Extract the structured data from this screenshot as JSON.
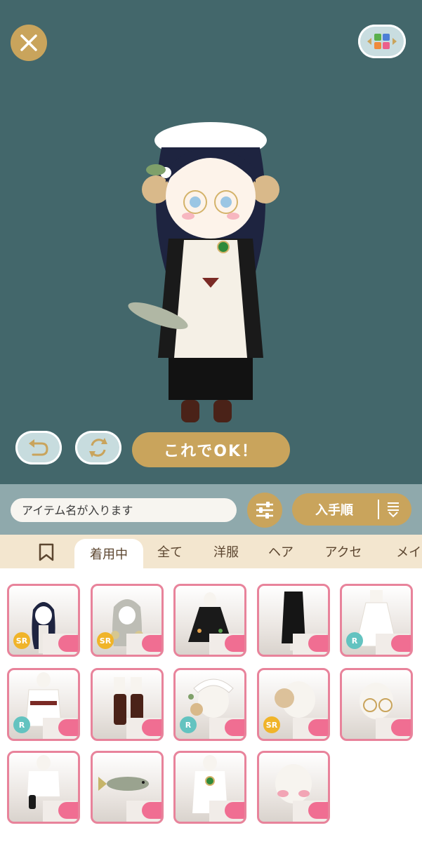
{
  "buttons": {
    "ok_label": "これでOK！",
    "close": "close-icon",
    "layout": "layout-grid-icon",
    "undo": "undo-icon",
    "swap": "swap-icon"
  },
  "search": {
    "placeholder": "アイテム名が入ります"
  },
  "sort": {
    "label": "入手順"
  },
  "tabs": [
    {
      "label": "着用中",
      "active": true
    },
    {
      "label": "全て"
    },
    {
      "label": "洋服"
    },
    {
      "label": "ヘア"
    },
    {
      "label": "アクセ"
    },
    {
      "label": "メイク"
    }
  ],
  "items": [
    {
      "name": "black long hair",
      "rarity": "SR"
    },
    {
      "name": "gray braided hair",
      "rarity": "SR"
    },
    {
      "name": "black embroidered cape",
      "rarity": ""
    },
    {
      "name": "black long skirt",
      "rarity": ""
    },
    {
      "name": "white apron dress",
      "rarity": "R"
    },
    {
      "name": "white blouse with bow",
      "rarity": "R"
    },
    {
      "name": "brown boots",
      "rarity": ""
    },
    {
      "name": "maid headdress with horns",
      "rarity": "R"
    },
    {
      "name": "ram horns",
      "rarity": "SR"
    },
    {
      "name": "round glasses",
      "rarity": ""
    },
    {
      "name": "black gloves",
      "rarity": ""
    },
    {
      "name": "fish",
      "rarity": ""
    },
    {
      "name": "green brooch bolo tie",
      "rarity": ""
    },
    {
      "name": "blush makeup",
      "rarity": ""
    }
  ],
  "colors": {
    "stage": "#43676b",
    "gold": "#c9a45c",
    "toolbar": "#8fa9ac",
    "tabbar": "#f3e6cf",
    "card_border": "#e8839b"
  }
}
